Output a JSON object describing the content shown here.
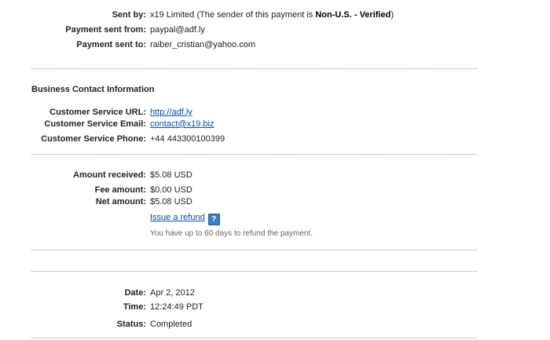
{
  "payment": {
    "sent_by_label": "Sent by:",
    "sent_by_name": "x19 Limited",
    "sent_by_note_pre": "(The sender of this payment is",
    "sent_by_status": "Non-U.S. - Verified",
    "sent_by_note_post": ")",
    "sent_from_label": "Payment sent from:",
    "sent_from_value": "paypal@adf.ly",
    "sent_to_label": "Payment sent to:",
    "sent_to_value": "raiber_cristian@yahoo.com"
  },
  "business": {
    "title": "Business Contact Information",
    "url_label": "Customer Service URL:",
    "url_value": "http://adf.ly",
    "email_label": "Customer Service Email:",
    "email_value": "contact@x19.biz",
    "phone_label": "Customer Service Phone:",
    "phone_value": "+44 443300100399"
  },
  "amounts": {
    "received_label": "Amount received:",
    "received_value": "$5.08 USD",
    "fee_label": "Fee amount:",
    "fee_value": "$0.00 USD",
    "net_label": "Net amount:",
    "net_value": "$5.08 USD",
    "refund_link": "Issue a refund",
    "help_glyph": "?",
    "refund_note": "You have up to 60 days to refund the payment."
  },
  "details": {
    "date_label": "Date:",
    "date_value": "Apr 2, 2012",
    "time_label": "Time:",
    "time_value": "12:24:49 PDT",
    "status_label": "Status:",
    "status_value": "Completed"
  },
  "icons": {
    "help": "help-question-icon"
  },
  "colors": {
    "link": "#0a4ca8",
    "help_icon_bg": "#3d7bc0",
    "divider": "#9a9a9a"
  }
}
